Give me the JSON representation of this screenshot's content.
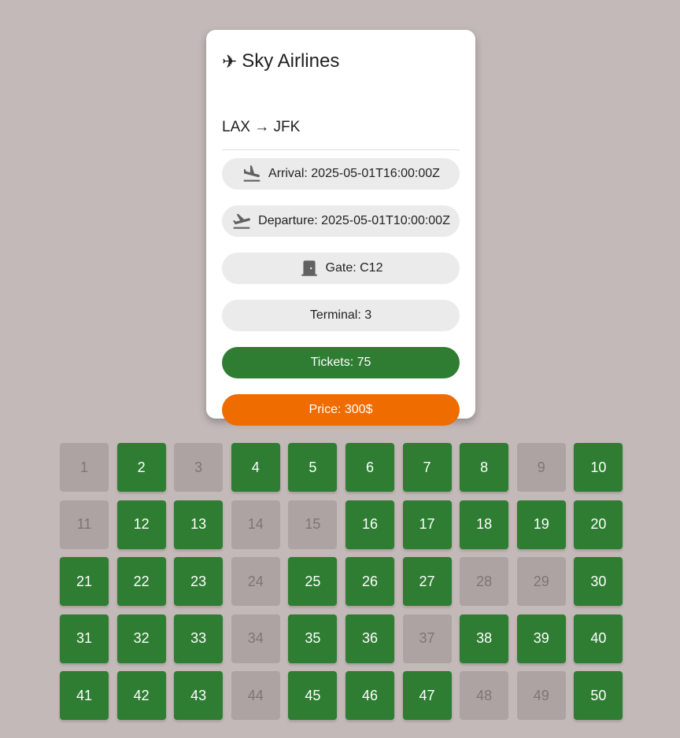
{
  "flight": {
    "airline": "Sky Airlines",
    "route": "LAX → JFK",
    "arrival": "Arrival: 2025-05-01T16:00:00Z",
    "departure": "Departure: 2025-05-01T10:00:00Z",
    "gate": "Gate: C12",
    "terminal": "Terminal: 3",
    "tickets": "Tickets: 75",
    "price": "Price: 300$"
  },
  "icons": {
    "title": "airplane-icon",
    "arrival": "flight-land-icon",
    "departure": "flight-takeoff-icon",
    "gate": "door-icon"
  },
  "colors": {
    "background": "#c4b9b9",
    "available_seat": "#2e7d32",
    "taken_seat": "#ada3a3",
    "tickets_button": "#2e7d32",
    "price_button": "#ef6c00"
  },
  "seats": [
    {
      "number": "1",
      "available": false
    },
    {
      "number": "2",
      "available": true
    },
    {
      "number": "3",
      "available": false
    },
    {
      "number": "4",
      "available": true
    },
    {
      "number": "5",
      "available": true
    },
    {
      "number": "6",
      "available": true
    },
    {
      "number": "7",
      "available": true
    },
    {
      "number": "8",
      "available": true
    },
    {
      "number": "9",
      "available": false
    },
    {
      "number": "10",
      "available": true
    },
    {
      "number": "11",
      "available": false
    },
    {
      "number": "12",
      "available": true
    },
    {
      "number": "13",
      "available": true
    },
    {
      "number": "14",
      "available": false
    },
    {
      "number": "15",
      "available": false
    },
    {
      "number": "16",
      "available": true
    },
    {
      "number": "17",
      "available": true
    },
    {
      "number": "18",
      "available": true
    },
    {
      "number": "19",
      "available": true
    },
    {
      "number": "20",
      "available": true
    },
    {
      "number": "21",
      "available": true
    },
    {
      "number": "22",
      "available": true
    },
    {
      "number": "23",
      "available": true
    },
    {
      "number": "24",
      "available": false
    },
    {
      "number": "25",
      "available": true
    },
    {
      "number": "26",
      "available": true
    },
    {
      "number": "27",
      "available": true
    },
    {
      "number": "28",
      "available": false
    },
    {
      "number": "29",
      "available": false
    },
    {
      "number": "30",
      "available": true
    },
    {
      "number": "31",
      "available": true
    },
    {
      "number": "32",
      "available": true
    },
    {
      "number": "33",
      "available": true
    },
    {
      "number": "34",
      "available": false
    },
    {
      "number": "35",
      "available": true
    },
    {
      "number": "36",
      "available": true
    },
    {
      "number": "37",
      "available": false
    },
    {
      "number": "38",
      "available": true
    },
    {
      "number": "39",
      "available": true
    },
    {
      "number": "40",
      "available": true
    },
    {
      "number": "41",
      "available": true
    },
    {
      "number": "42",
      "available": true
    },
    {
      "number": "43",
      "available": true
    },
    {
      "number": "44",
      "available": false
    },
    {
      "number": "45",
      "available": true
    },
    {
      "number": "46",
      "available": true
    },
    {
      "number": "47",
      "available": true
    },
    {
      "number": "48",
      "available": false
    },
    {
      "number": "49",
      "available": false
    },
    {
      "number": "50",
      "available": true
    }
  ]
}
